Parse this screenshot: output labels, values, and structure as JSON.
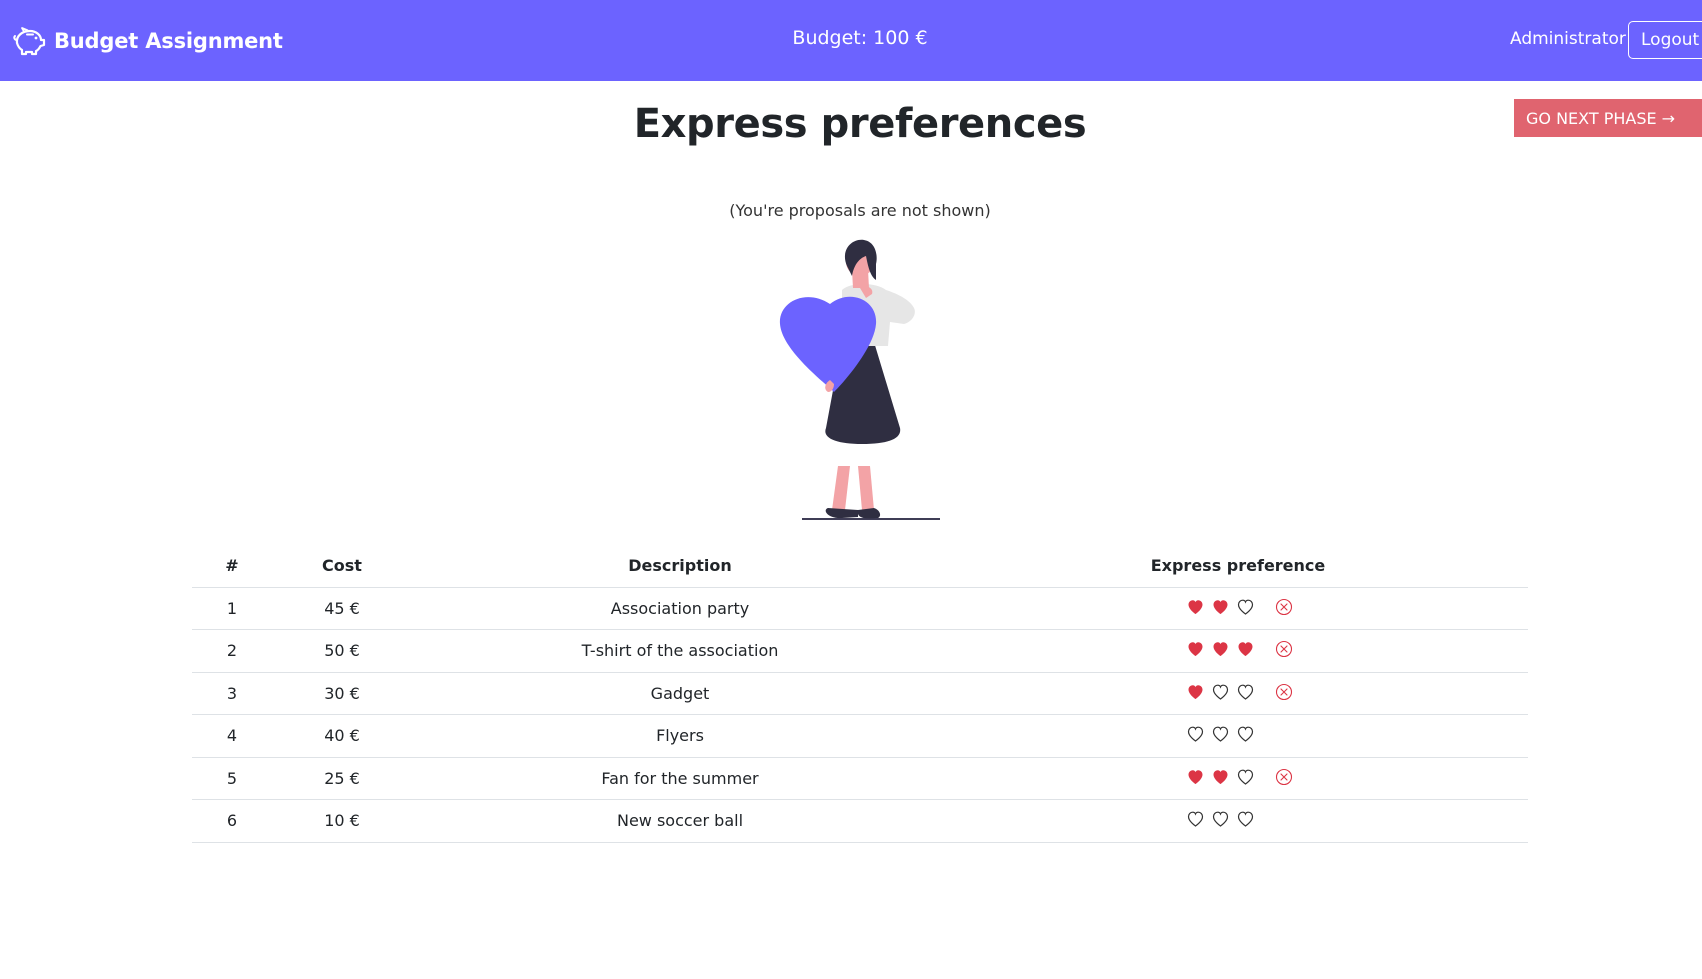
{
  "navbar": {
    "brand": "Budget Assignment",
    "brand_icon": "piggy-bank-icon",
    "budget": "Budget: 100 €",
    "user": "Administrator",
    "logout_label": "Logout",
    "background_color": "#6c63ff"
  },
  "main": {
    "title": "Express preferences",
    "next_phase_label": "GO NEXT PHASE →",
    "next_phase_color": "#e0646f",
    "note": "(You're proposals are not shown)",
    "illustration": "woman-holding-heart-illustration"
  },
  "table": {
    "headers": [
      "#",
      "Cost",
      "Description",
      "Express preference"
    ],
    "max_preference": 3,
    "heart_color": "#dc3545",
    "rows": [
      {
        "num": "1",
        "cost": "45 €",
        "description": "Association party",
        "preference": 2
      },
      {
        "num": "2",
        "cost": "50 €",
        "description": "T-shirt of the association",
        "preference": 3
      },
      {
        "num": "3",
        "cost": "30 €",
        "description": "Gadget",
        "preference": 1
      },
      {
        "num": "4",
        "cost": "40 €",
        "description": "Flyers",
        "preference": 0
      },
      {
        "num": "5",
        "cost": "25 €",
        "description": "Fan for the summer",
        "preference": 2
      },
      {
        "num": "6",
        "cost": "10 €",
        "description": "New soccer ball",
        "preference": 0
      }
    ]
  }
}
